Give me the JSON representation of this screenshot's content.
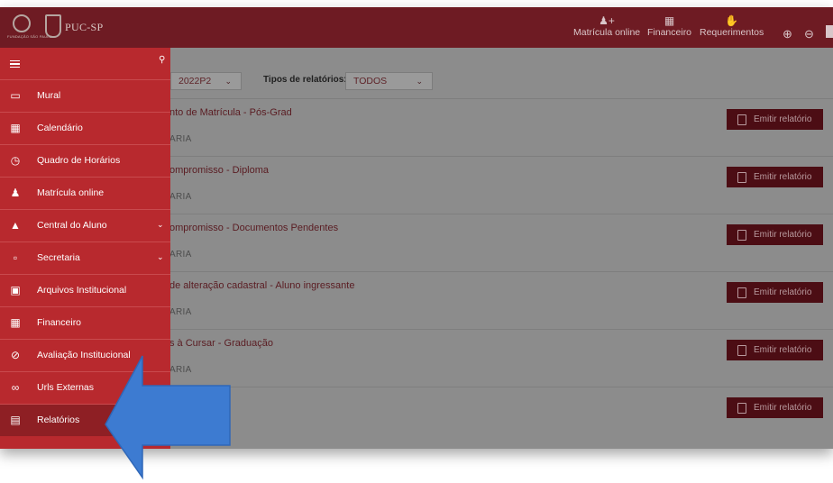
{
  "header": {
    "logo_text": "PUC-SP",
    "seal_caption": "FUNDAÇÃO SÃO PAULO",
    "links": [
      {
        "label": "Matrícula online",
        "icon": "user-plus-icon"
      },
      {
        "label": "Financeiro",
        "icon": "money-icon"
      },
      {
        "label": "Requerimentos",
        "icon": "hand-icon"
      }
    ]
  },
  "filters": {
    "period_value": "2022P2",
    "report_type_label": "Tipos de relatórios:",
    "report_type_value": "TODOS"
  },
  "reports": [
    {
      "title": "nto de Matrícula - Pós-Grad",
      "sub": "ARIA",
      "button": "Emitir relatório"
    },
    {
      "title": "ompromisso - Diploma",
      "sub": "ARIA",
      "button": "Emitir relatório"
    },
    {
      "title": "ompromisso - Documentos Pendentes",
      "sub": "ARIA",
      "button": "Emitir relatório"
    },
    {
      "title": "de alteração cadastral - Aluno ingressante",
      "sub": "ARIA",
      "button": "Emitir relatório"
    },
    {
      "title": "s à Cursar - Graduação",
      "sub": "ARIA",
      "button": "Emitir relatório"
    },
    {
      "title": "cula",
      "sub": "",
      "button": "Emitir relatório"
    }
  ],
  "sidebar": {
    "items": [
      {
        "label": "Mural",
        "icon": "monitor-icon"
      },
      {
        "label": "Calendário",
        "icon": "calendar-icon"
      },
      {
        "label": "Quadro de Horários",
        "icon": "clock-icon"
      },
      {
        "label": "Matrícula online",
        "icon": "user-plus-icon"
      },
      {
        "label": "Central do Aluno",
        "icon": "graduation-cap-icon"
      },
      {
        "label": "Secretaria",
        "icon": "clipboard-icon"
      },
      {
        "label": "Arquivos Institucional",
        "icon": "inbox-icon"
      },
      {
        "label": "Financeiro",
        "icon": "money-icon"
      },
      {
        "label": "Avaliação Institucional",
        "icon": "no-entry-icon"
      },
      {
        "label": "Urls Externas",
        "icon": "link-icon"
      },
      {
        "label": "Relatórios",
        "icon": "file-icon"
      }
    ]
  },
  "colors": {
    "brand": "#6e1b23",
    "sidebar": "#b8292e",
    "active": "#8e1f24",
    "button": "#4c0d14",
    "arrow": "#3d7bd1"
  }
}
